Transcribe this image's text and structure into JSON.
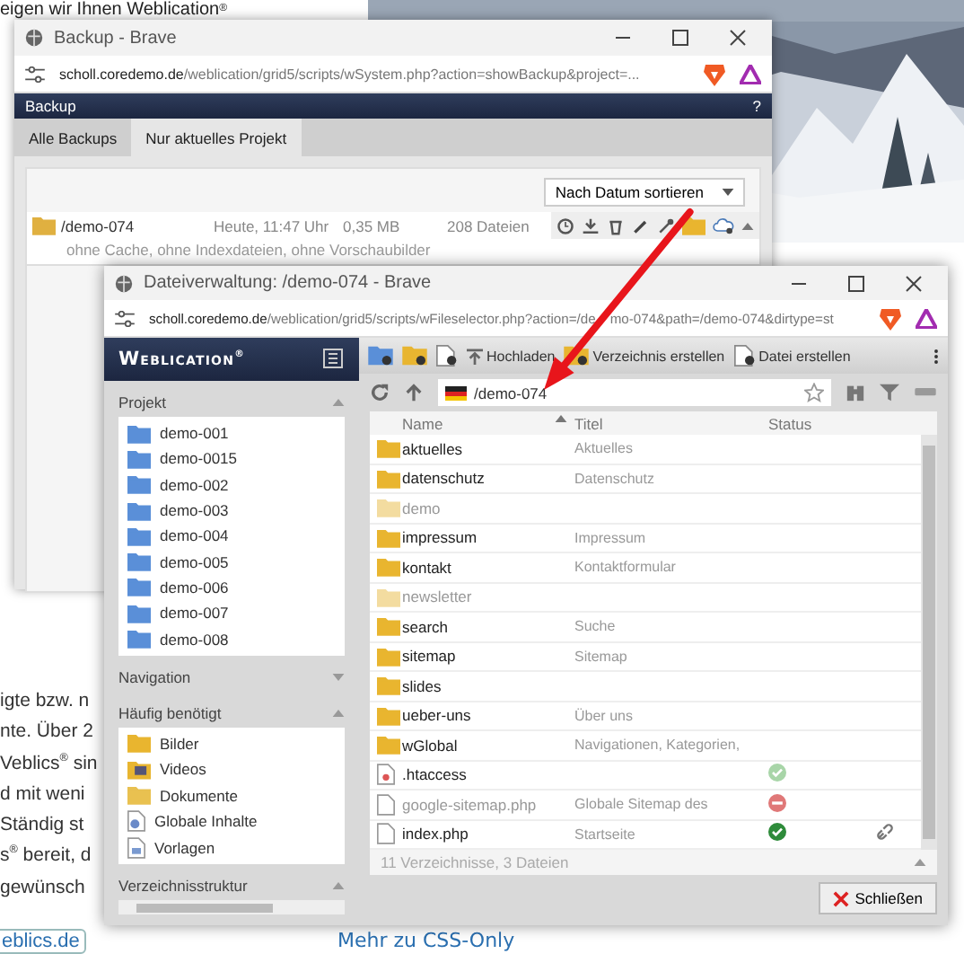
{
  "background_page": {
    "headline": "eigen wir Ihnen Weblication$^{®}$",
    "text_fragments": [
      "igte bzw. n",
      "nte. Über 2",
      "Veblics$^{®}$ sin",
      "d mit weni",
      "Ständig st",
      "s$^{®}$ bereit, d",
      "gewünsch"
    ],
    "link_button": "eblics.de",
    "link": "Mehr zu CSS-Only"
  },
  "backup_window": {
    "title": "Backup - Brave",
    "url_host": "scholl.coredemo.de",
    "url_path": "/weblication/grid5/scripts/wSystem.php?action=showBackup&project=...",
    "header": "Backup",
    "help": "?",
    "tabs": [
      {
        "label": "Alle Backups",
        "selected": false
      },
      {
        "label": "Nur aktuelles Projekt",
        "selected": true
      }
    ],
    "sort": "Nach Datum sortieren",
    "backups": [
      {
        "path": "/demo-074",
        "date": "Heute, 11:47 Uhr",
        "size": "0,35 MB",
        "files": "208 Dateien",
        "note": "ohne Cache, ohne Indexdateien, ohne Vorschaubilder"
      }
    ]
  },
  "file_window": {
    "title": "Dateiverwaltung: /demo-074 - Brave",
    "url_host": "scholl.coredemo.de",
    "url_path": "/weblication/grid5/scripts/wFileselector.php?action=/de",
    "url_path_rest": "mo-074&path=/demo-074&dirtype=st",
    "logo": "Weblication$^{®}$",
    "toolbar": [
      "Hochladen",
      "Verzeichnis erstellen",
      "Datei erstellen"
    ],
    "path": "/demo-074",
    "sidebar": [
      {
        "title": "Projekt",
        "expanded": true,
        "kind": "projects",
        "items": [
          "demo-001",
          "demo-0015",
          "demo-002",
          "demo-003",
          "demo-004",
          "demo-005",
          "demo-006",
          "demo-007",
          "demo-008"
        ]
      },
      {
        "title": "Navigation",
        "expanded": false
      },
      {
        "title": "Häufig benötigt",
        "expanded": true,
        "kind": "shortcuts",
        "items": [
          "Bilder",
          "Videos",
          "Dokumente",
          "Globale Inhalte",
          "Vorlagen"
        ]
      },
      {
        "title": "Verzeichnisstruktur",
        "expanded": true,
        "kind": "tree"
      }
    ],
    "columns": [
      "Name",
      "Titel",
      "Status"
    ],
    "rows": [
      {
        "kind": "folder",
        "name": "aktuelles",
        "title": "Aktuelles",
        "dimmed": false
      },
      {
        "kind": "folder",
        "name": "datenschutz",
        "title": "Datenschutz",
        "dimmed": false
      },
      {
        "kind": "folder",
        "name": "demo",
        "dimmed": true
      },
      {
        "kind": "folder",
        "name": "impressum",
        "title": "Impressum",
        "dimmed": false
      },
      {
        "kind": "folder",
        "name": "kontakt",
        "title": "Kontaktformular",
        "dimmed": false
      },
      {
        "kind": "folder",
        "name": "newsletter",
        "dimmed": true
      },
      {
        "kind": "folder",
        "name": "search",
        "title": "Suche",
        "dimmed": false
      },
      {
        "kind": "folder",
        "name": "sitemap",
        "title": "Sitemap",
        "dimmed": false
      },
      {
        "kind": "folder",
        "name": "slides",
        "dimmed": false
      },
      {
        "kind": "folder",
        "name": "ueber-uns",
        "title": "Über uns",
        "dimmed": false
      },
      {
        "kind": "folder",
        "name": "wGlobal",
        "title": "Navigationen, Kategorien,",
        "dimmed": false
      },
      {
        "kind": "config",
        "name": ".htaccess",
        "status": {
          "kind": "ok-faded"
        },
        "dimmed": false
      },
      {
        "kind": "file",
        "name": "google-sitemap.php",
        "title": "Globale Sitemap des",
        "status": {
          "kind": "blocked"
        },
        "dimmed": true
      },
      {
        "kind": "file",
        "name": "index.php",
        "title": "Startseite",
        "status": {
          "kind": "ok"
        },
        "linked": true,
        "dimmed": false
      }
    ],
    "footer": "11 Verzeichnisse, 3 Dateien",
    "close_button": "Schließen"
  }
}
